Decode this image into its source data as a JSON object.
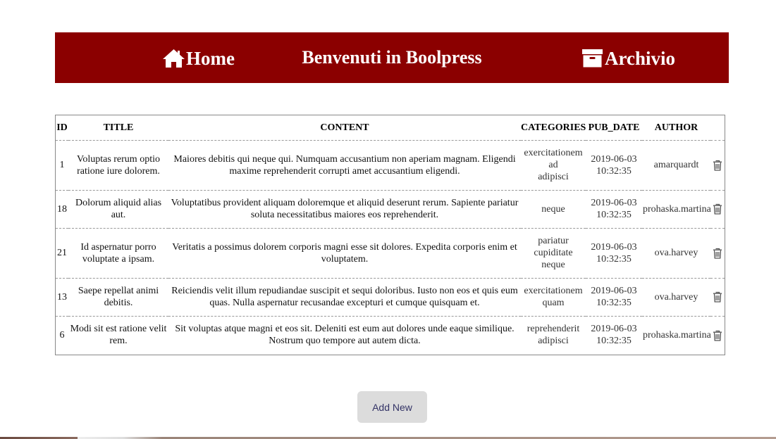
{
  "header": {
    "home_label": "Home",
    "home_icon": "home-icon",
    "title": "Benvenuti in Boolpress",
    "archive_label": "Archivio",
    "archive_icon": "archive-icon",
    "background": "#8b0000"
  },
  "table": {
    "columns": [
      "ID",
      "TITLE",
      "CONTENT",
      "CATEGORIES",
      "PUB_DATE",
      "AUTHOR"
    ],
    "rows": [
      {
        "id": "1",
        "title": "Voluptas rerum optio ratione iure dolorem.",
        "content": "Maiores debitis qui neque qui. Numquam accusantium non aperiam magnam. Eligendi maxime reprehenderit corrupti amet accusantium eligendi.",
        "categories": [
          "exercitationem",
          "ad",
          "adipisci"
        ],
        "pub_date": "2019-06-03 10:32:35",
        "author": "amarquardt"
      },
      {
        "id": "18",
        "title": "Dolorum aliquid alias aut.",
        "content": "Voluptatibus provident aliquam doloremque et aliquid deserunt rerum. Sapiente pariatur soluta necessitatibus maiores eos reprehenderit.",
        "categories": [
          "neque"
        ],
        "pub_date": "2019-06-03 10:32:35",
        "author": "prohaska.martina"
      },
      {
        "id": "21",
        "title": "Id aspernatur porro voluptate a ipsam.",
        "content": "Veritatis a possimus dolorem corporis magni esse sit dolores. Expedita corporis enim et voluptatem.",
        "categories": [
          "pariatur",
          "cupiditate",
          "neque"
        ],
        "pub_date": "2019-06-03 10:32:35",
        "author": "ova.harvey"
      },
      {
        "id": "13",
        "title": "Saepe repellat animi debitis.",
        "content": "Reiciendis velit illum repudiandae suscipit et sequi doloribus. Iusto non eos et quis eum quas. Nulla aspernatur recusandae excepturi et cumque quisquam et.",
        "categories": [
          "exercitationem",
          "quam"
        ],
        "pub_date": "2019-06-03 10:32:35",
        "author": "ova.harvey"
      },
      {
        "id": "6",
        "title": "Modi sit est ratione velit rem.",
        "content": "Sit voluptas atque magni et eos sit. Deleniti est eum aut dolores unde eaque similique. Nostrum quo tempore aut autem dicta.",
        "categories": [
          "reprehenderit",
          "adipisci"
        ],
        "pub_date": "2019-06-03 10:32:35",
        "author": "prohaska.martina"
      }
    ],
    "delete_icon": "trash-icon"
  },
  "add_button": {
    "label": "Add New"
  }
}
